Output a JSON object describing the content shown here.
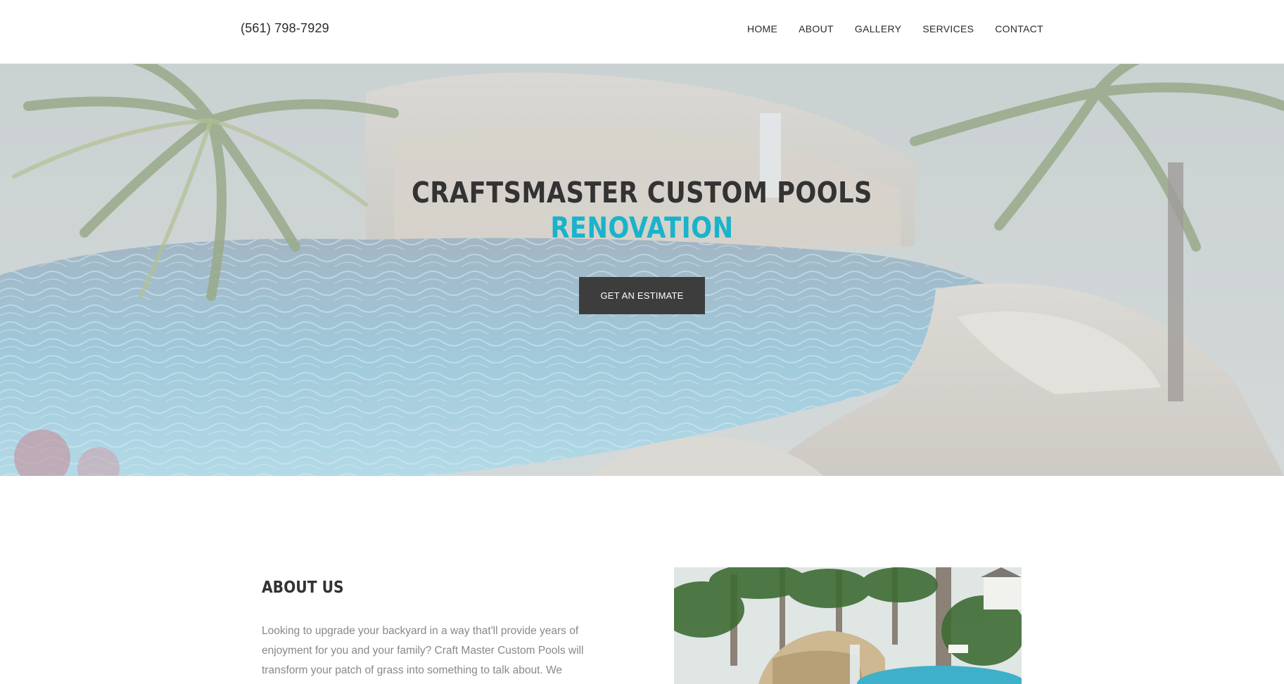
{
  "header": {
    "phone": "(561) 798-7929",
    "nav": [
      "HOME",
      "ABOUT",
      "GALLERY",
      "SERVICES",
      "CONTACT"
    ]
  },
  "hero": {
    "title": "CRAFTSMASTER CUSTOM POOLS",
    "subtitle": "RENOVATION",
    "cta_label": "GET AN ESTIMATE",
    "image": "pool-with-palm-trees-and-rock-waterfall-photo"
  },
  "about": {
    "heading": "ABOUT US",
    "text": "Looking to upgrade your backyard in a way that'll provide years of enjoyment for you and your family? Craft Master Custom Pools will transform your patch of grass into something to talk about. We",
    "image": "pool-with-rock-waterfall-and-palm-trees-photo"
  },
  "colors": {
    "accent": "#19b3cb",
    "text_dark": "#333333",
    "button_bg": "#3d3d3d",
    "body_text": "#888888"
  }
}
